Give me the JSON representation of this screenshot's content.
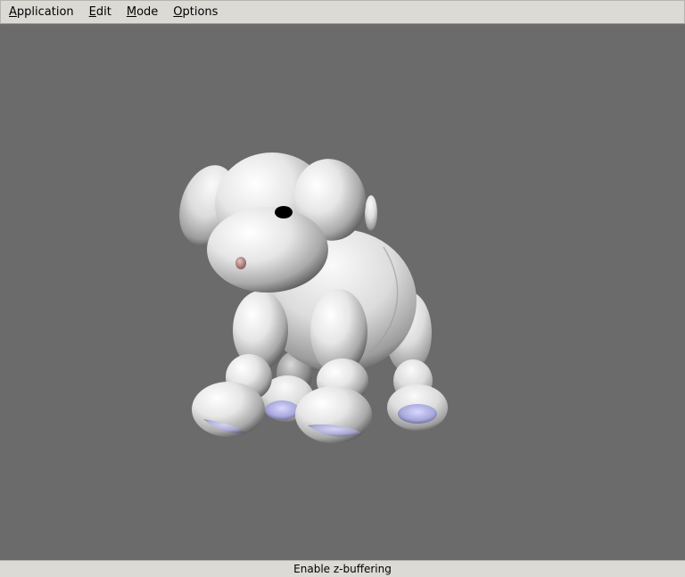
{
  "menubar": {
    "items": [
      {
        "mnemonic": "A",
        "rest": "pplication"
      },
      {
        "mnemonic": "E",
        "rest": "dit"
      },
      {
        "mnemonic": "M",
        "rest": "ode"
      },
      {
        "mnemonic": "O",
        "rest": "ptions"
      }
    ]
  },
  "status": {
    "text": "Enable z-buffering"
  },
  "colors": {
    "background": "#6b6b6b",
    "menubar": "#dcdad5",
    "model_body": "#e8e8e8",
    "paw_pads": "#b8b8e8",
    "nose": "#c49a96",
    "eye": "#000000"
  }
}
